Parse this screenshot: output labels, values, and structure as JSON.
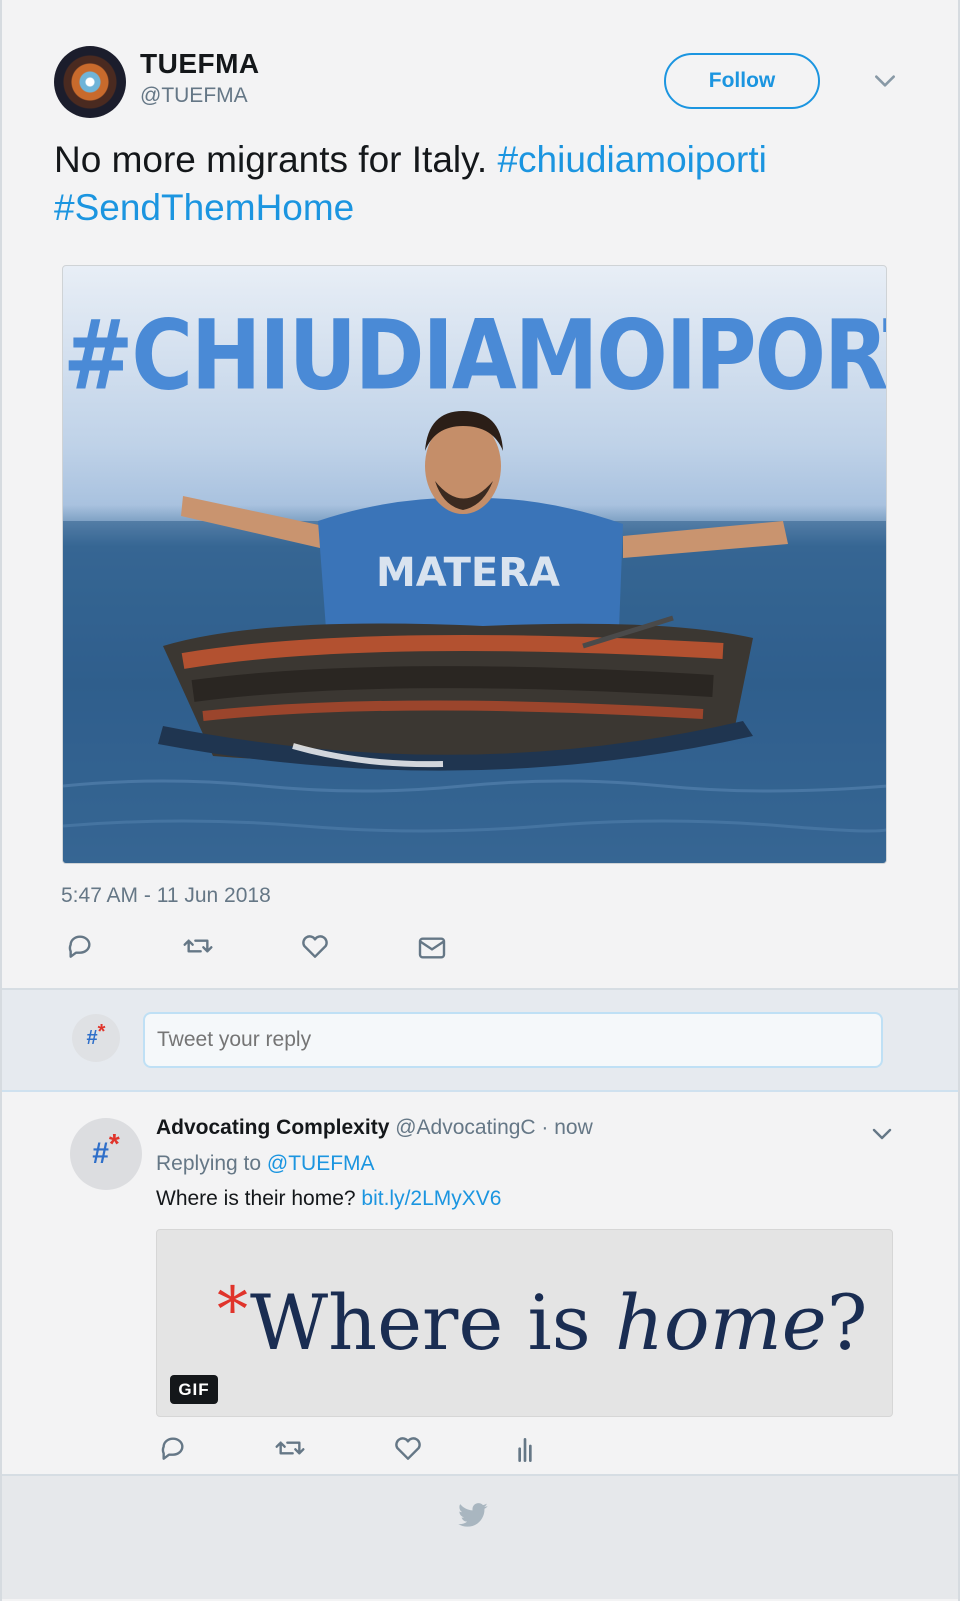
{
  "tweet": {
    "display_name": "TUEFMA",
    "handle": "@TUEFMA",
    "follow_label": "Follow",
    "text_plain": "No more migrants for Italy. ",
    "hashtag1": "#chiudiamoiporti",
    "hashtag2": "#SendThemHome",
    "media_title": "#CHIUDIAMOIPORTI",
    "media_shirt_text": "MATERA",
    "timestamp": "5:47 AM - 11 Jun 2018",
    "actions": [
      "reply-icon",
      "retweet-icon",
      "like-icon",
      "dm-icon"
    ]
  },
  "reply_box": {
    "avatar_text": "#",
    "avatar_mark": "*",
    "placeholder": "Tweet your reply"
  },
  "reply": {
    "display_name": "Advocating Complexity",
    "meta": " @AdvocatingC · now",
    "replying_prefix": "Replying to ",
    "replying_handle": "@TUEFMA",
    "text": "Where is their home? ",
    "link": "bit.ly/2LMyXV6",
    "gif": {
      "star": "*",
      "headline_plain": "Where is ",
      "headline_italic": "home",
      "headline_end": "?",
      "badge": "GIF"
    },
    "actions": [
      "reply-icon",
      "retweet-icon",
      "like-icon",
      "analytics-icon"
    ]
  },
  "colors": {
    "accent": "#1b95e0",
    "text": "#14171a",
    "muted": "#657786",
    "gif_red": "#e0342b",
    "gif_navy": "#1a2d52"
  }
}
